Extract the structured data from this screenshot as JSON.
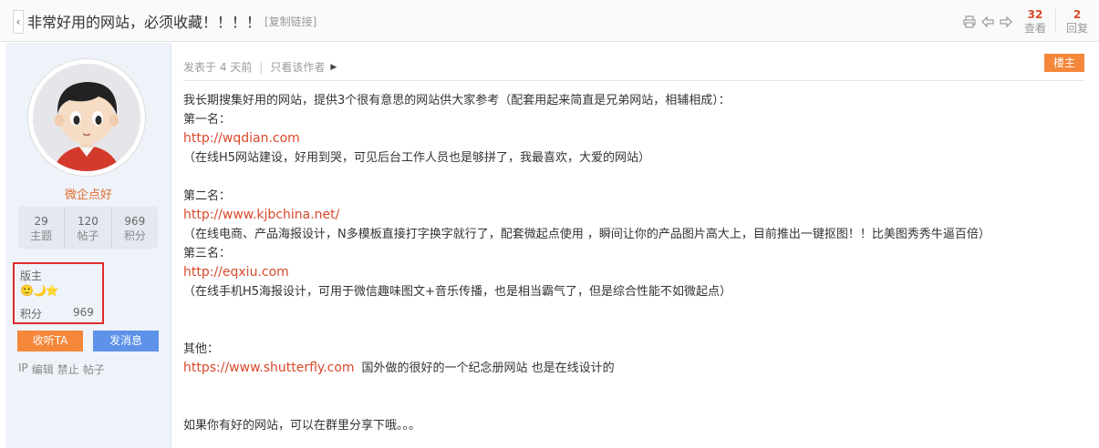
{
  "header": {
    "back_glyph": "‹",
    "title": "非常好用的网站，必须收藏！！！！",
    "copy_link": "[复制链接]",
    "views_count": "32",
    "views_label": "查看",
    "replies_count": "2",
    "replies_label": "回复"
  },
  "user": {
    "name": "微企点好",
    "stats": [
      {
        "num": "29",
        "label": "主题"
      },
      {
        "num": "120",
        "label": "帖子"
      },
      {
        "num": "969",
        "label": "积分"
      }
    ],
    "rank": "版主",
    "medals": "🙂🌙⭐",
    "score_label": "积分",
    "score_value": "969",
    "follow_button": "收听TA",
    "message_button": "发消息",
    "admin_links": [
      "IP",
      "编辑",
      "禁止",
      "帖子"
    ]
  },
  "post": {
    "posted_time": "发表于 4 天前",
    "only_author": "只看该作者",
    "floor_badge": "楼主",
    "lines": [
      {
        "type": "text",
        "text": "我长期搜集好用的网站，提供3个很有意思的网站供大家参考（配套用起来简直是兄弟网站，相辅相成）："
      },
      {
        "type": "text",
        "text": "第一名："
      },
      {
        "type": "link",
        "text": "http://wqdian.com"
      },
      {
        "type": "text",
        "text": "（在线H5网站建设，好用到哭，可见后台工作人员也是够拼了，我最喜欢，大爱的网站）"
      },
      {
        "type": "gap",
        "text": ""
      },
      {
        "type": "text",
        "text": "第二名："
      },
      {
        "type": "link",
        "text": "http://www.kjbchina.net/"
      },
      {
        "type": "text",
        "text": "（在线电商、产品海报设计，N多模板直接打字换字就行了，配套微起点使用 ，瞬间让你的产品图片高大上，目前推出一键抠图！！比美图秀秀牛逼百倍）"
      },
      {
        "type": "text",
        "text": "第三名："
      },
      {
        "type": "link",
        "text": "http://eqxiu.com"
      },
      {
        "type": "text",
        "text": "（在线手机H5海报设计，可用于微信趣味图文+音乐传播，也是相当霸气了，但是综合性能不如微起点）"
      },
      {
        "type": "gap",
        "text": ""
      },
      {
        "type": "gap",
        "text": ""
      },
      {
        "type": "text",
        "text": "其他："
      },
      {
        "type": "mixed",
        "link": "https://www.shutterfly.com",
        "text": "国外做的很好的一个纪念册网站  也是在线设计的"
      },
      {
        "type": "gap",
        "text": ""
      },
      {
        "type": "gap",
        "text": ""
      },
      {
        "type": "text",
        "text": "如果你有好的网站，可以在群里分享下哦。。。"
      }
    ]
  },
  "icons": {
    "print": "print-icon",
    "prev": "prev-thread-icon",
    "next": "next-thread-icon"
  }
}
